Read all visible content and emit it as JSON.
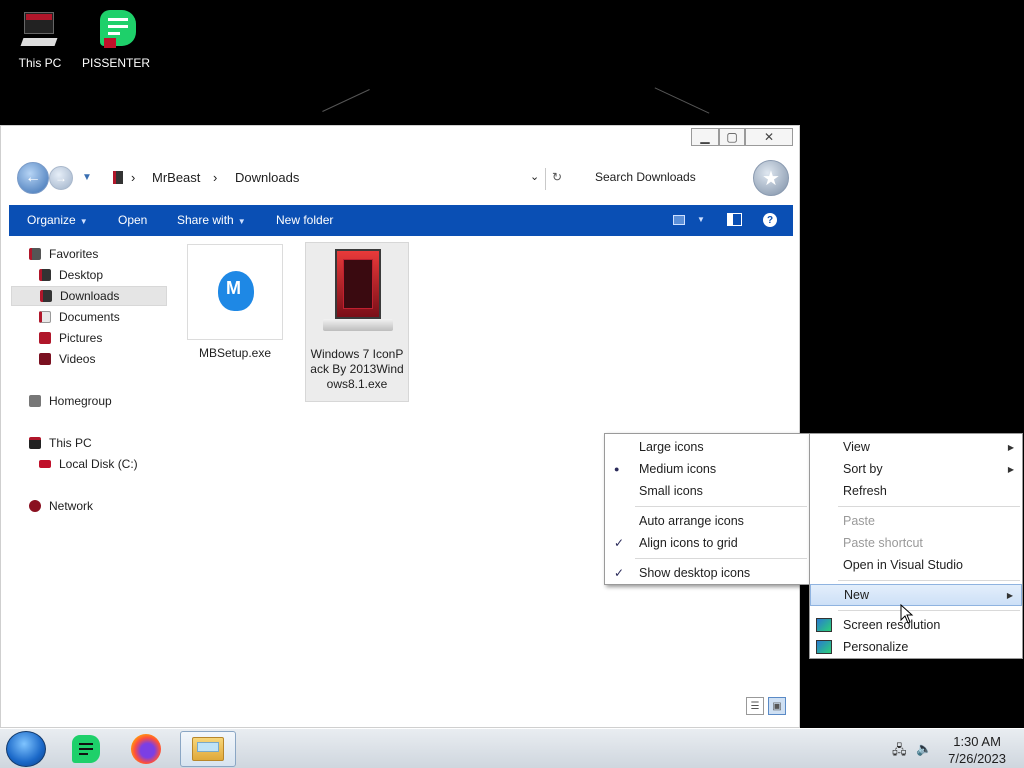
{
  "desktop": {
    "icons": [
      {
        "label": "This PC"
      },
      {
        "label": "PISSENTER"
      }
    ]
  },
  "explorer": {
    "window_controls": {
      "minimize": "▁",
      "maximize": "▢",
      "close": "✕"
    },
    "breadcrumb": [
      "MrBeast",
      "Downloads"
    ],
    "search_placeholder": "Search Downloads",
    "command_bar": {
      "organize": "Organize",
      "open": "Open",
      "share_with": "Share with",
      "new_folder": "New folder"
    },
    "nav": {
      "favorites": "Favorites",
      "desktop": "Desktop",
      "downloads": "Downloads",
      "documents": "Documents",
      "pictures": "Pictures",
      "videos": "Videos",
      "homegroup": "Homegroup",
      "this_pc": "This PC",
      "local_disk": "Local Disk (C:)",
      "network": "Network"
    },
    "files": [
      {
        "name": "MBSetup.exe",
        "icon": "malwarebytes-icon"
      },
      {
        "name": "Windows 7 IconPack By 2013Windows8.1.exe",
        "icon": "pc-tower-icon"
      }
    ]
  },
  "view_submenu": {
    "items": [
      {
        "label": "Large icons",
        "mark": ""
      },
      {
        "label": "Medium icons",
        "mark": "●"
      },
      {
        "label": "Small icons",
        "mark": ""
      },
      {
        "label": "Auto arrange icons",
        "mark": ""
      },
      {
        "label": "Align icons to grid",
        "mark": "✓"
      },
      {
        "label": "Show desktop icons",
        "mark": "✓"
      }
    ]
  },
  "desktop_menu": {
    "view": "View",
    "sort_by": "Sort by",
    "refresh": "Refresh",
    "paste": "Paste",
    "paste_shortcut": "Paste shortcut",
    "open_vs": "Open in Visual Studio",
    "new": "New",
    "screen_resolution": "Screen resolution",
    "personalize": "Personalize"
  },
  "taskbar": {
    "time": "1:30 AM",
    "date": "7/26/2023"
  },
  "colors": {
    "command_bar": "#0a4fb4",
    "menu_highlight": "#cde0f7"
  }
}
